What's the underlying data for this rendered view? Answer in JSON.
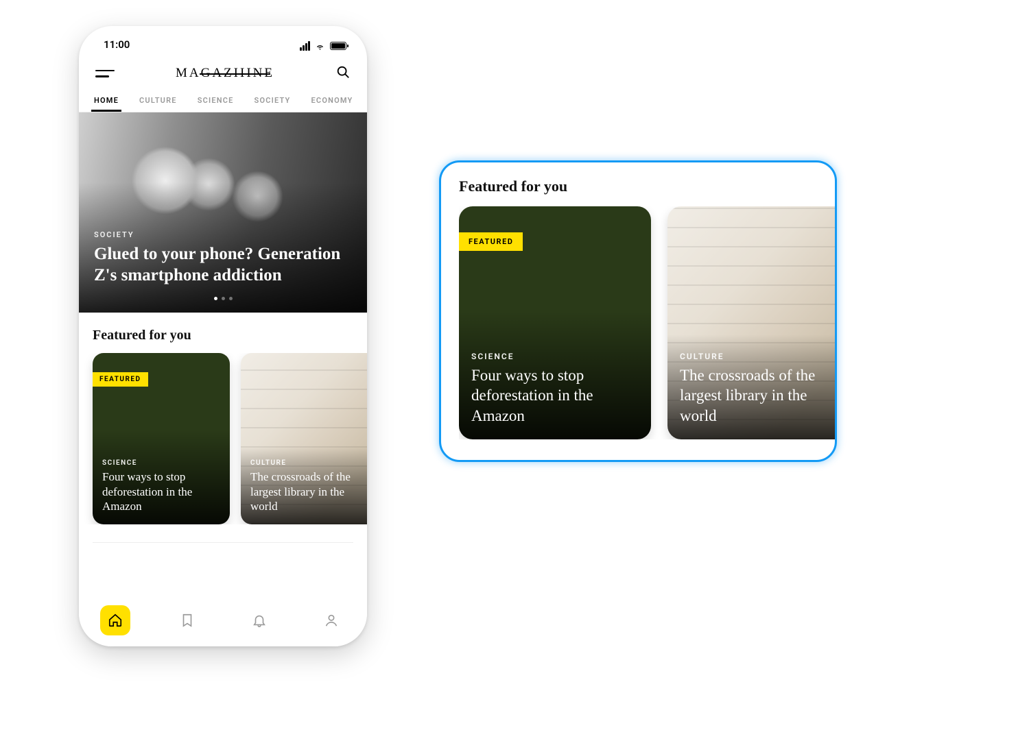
{
  "status": {
    "time": "11:00"
  },
  "brand": "MAGAZIIINE",
  "tabs": [
    "HOME",
    "CULTURE",
    "SCIENCE",
    "SOCIETY",
    "ECONOMY"
  ],
  "active_tab_index": 0,
  "hero": {
    "category": "SOCIETY",
    "title": "Glued to your phone? Generation Z's smartphone addiction",
    "dot_count": 3,
    "active_dot": 0
  },
  "featured_section_title": "Featured for you",
  "featured_tag_label": "FEATURED",
  "featured_cards": [
    {
      "category": "SCIENCE",
      "title": "Four ways to stop deforestation in the Amazon",
      "featured": true,
      "style": "forest"
    },
    {
      "category": "CULTURE",
      "title": "The crossroads of the largest library in the world",
      "featured": false,
      "style": "library"
    }
  ],
  "tabbar": [
    "home",
    "bookmark",
    "bell",
    "profile"
  ],
  "active_tabbar_index": 0,
  "accent_color": "#ffe000",
  "highlight_color": "#139af5"
}
